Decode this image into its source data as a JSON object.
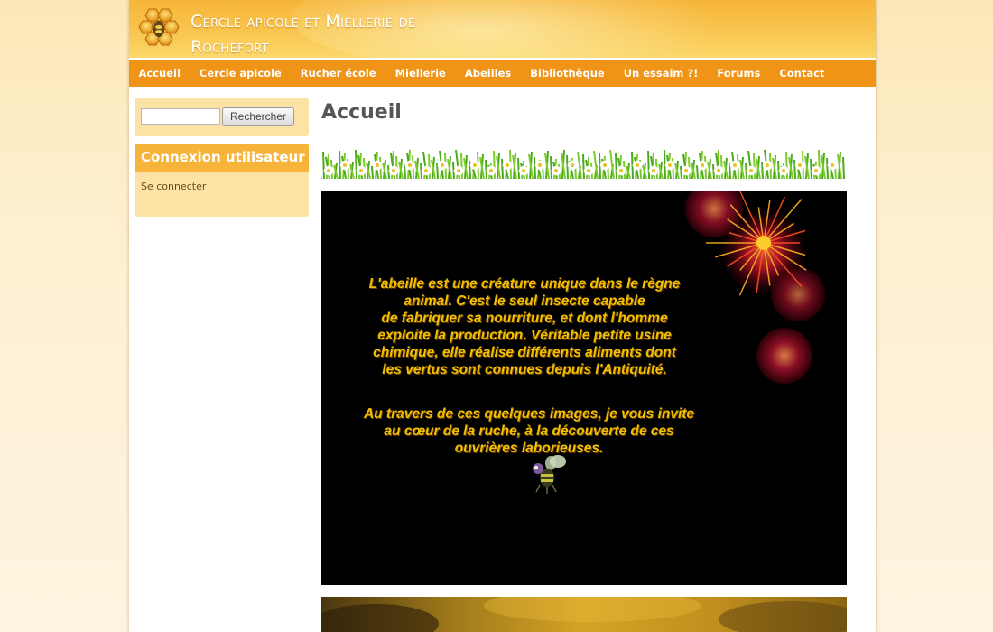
{
  "header": {
    "site_name_line1": "Cercle apicole et Miellerie de",
    "site_name_line2": "Rochefort"
  },
  "nav": {
    "items": [
      {
        "label": "Accueil",
        "name": "nav-item-accueil"
      },
      {
        "label": "Cercle apicole",
        "name": "nav-item-cercle-apicole"
      },
      {
        "label": "Rucher école",
        "name": "nav-item-rucher-ecole"
      },
      {
        "label": "Miellerie",
        "name": "nav-item-miellerie"
      },
      {
        "label": "Abeilles",
        "name": "nav-item-abeilles"
      },
      {
        "label": "Bibliothèque",
        "name": "nav-item-bibliotheque"
      },
      {
        "label": "Un essaim ?!",
        "name": "nav-item-un-essaim"
      },
      {
        "label": "Forums",
        "name": "nav-item-forums"
      },
      {
        "label": "Contact",
        "name": "nav-item-contact"
      }
    ]
  },
  "search": {
    "value": "",
    "button_label": "Rechercher"
  },
  "login": {
    "title": "Connexion utilisateur",
    "link_label": "Se connecter"
  },
  "main": {
    "title": "Accueil",
    "quote_paragraph1": [
      "L'abeille est une créature unique dans le règne",
      "animal. C'est le seul insecte capable",
      "de fabriquer sa nourriture, et dont l'homme",
      "exploite la production. Véritable petite usine",
      "chimique, elle réalise différents aliments dont",
      "les vertus sont connues depuis l'Antiquité."
    ],
    "quote_paragraph2": [
      "Au travers de ces quelques images, je vous invite",
      "au cœur de la ruche, à la découverte de ces",
      "ouvrières laborieuses."
    ]
  },
  "colors": {
    "header": "#f6b53a",
    "nav": "#f09417",
    "sidebar_block": "#fde2a6",
    "quote_text": "#f0c000"
  }
}
